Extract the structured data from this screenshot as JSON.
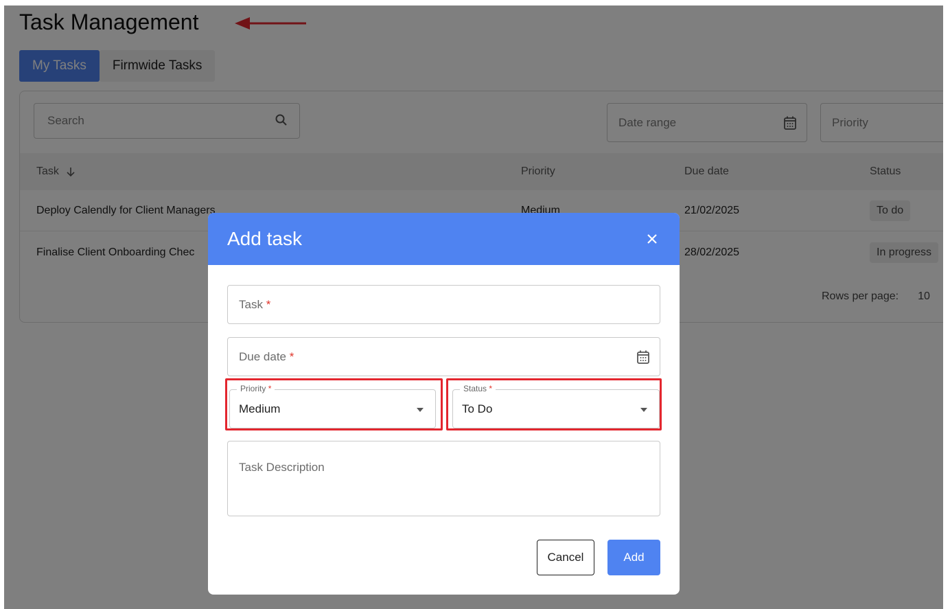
{
  "page": {
    "title": "Task Management"
  },
  "tabs": [
    {
      "label": "My Tasks",
      "active": true
    },
    {
      "label": "Firmwide Tasks",
      "active": false
    }
  ],
  "filters": {
    "search_placeholder": "Search",
    "date_range_placeholder": "Date range",
    "priority_placeholder": "Priority"
  },
  "table": {
    "columns": [
      "Task",
      "Priority",
      "Due date",
      "Status"
    ],
    "rows": [
      {
        "task": "Deploy Calendly for Client Managers",
        "priority": "Medium",
        "due": "21/02/2025",
        "status": "To do"
      },
      {
        "task": "Finalise Client Onboarding Chec",
        "priority": "",
        "due": "28/02/2025",
        "status": "In progress"
      }
    ],
    "rows_per_page_label": "Rows per page:",
    "rows_per_page_value": "10"
  },
  "modal": {
    "title": "Add task",
    "task_label": "Task",
    "due_label": "Due date",
    "required_mark": "*",
    "priority_label": "Priority",
    "priority_value": "Medium",
    "status_label": "Status",
    "status_value": "To Do",
    "description_placeholder": "Task Description",
    "cancel_label": "Cancel",
    "add_label": "Add"
  },
  "colors": {
    "accent": "#4f83f1",
    "highlight": "#e3262e",
    "required": "#e0352b"
  },
  "icons": {
    "close": "close-icon",
    "calendar": "calendar-icon",
    "search": "search-icon",
    "caret": "chevron-down-icon",
    "arrow": "arrow-left-icon"
  }
}
